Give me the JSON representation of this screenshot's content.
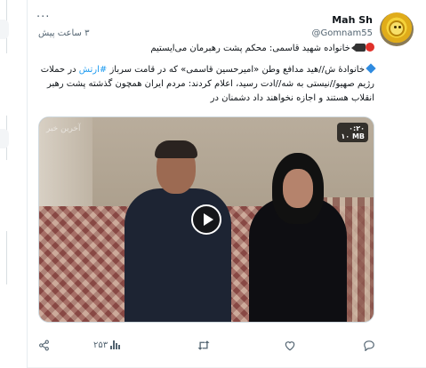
{
  "author": {
    "display_name": "Mah Sh",
    "handle": "@Gomnam55",
    "time": "۳ ساعت پیش"
  },
  "post": {
    "line1": "خانواده شهید قاسمی: محکم پشت رهبرمان می‌ایستیم",
    "line2_before_tag": "خانوادهٔ ش//هید مدافع وطن «امیرحسین قاسمی» که در قامت سرباز ",
    "hashtag": "#ارتش",
    "line2_after_tag": " در حملات رژیم صهیو//نیستی به شه//ادت رسید، اعلام کردند: مردم ایران همچون گذشته پشت رهبر انقلاب هستند و اجازه نخواهند داد دشمنان در"
  },
  "media": {
    "duration": "۰:۲۰",
    "size": "۱۰ MB",
    "watermark": "آخرین خبر"
  },
  "actions": {
    "views": "۲۵۳"
  },
  "icons": {
    "more": "more-icon",
    "play": "play-icon",
    "share": "share-icon",
    "views": "views-icon",
    "reply": "reply-icon",
    "retweet": "retweet-icon",
    "like": "like-icon",
    "bookmark": "bookmark-icon"
  }
}
